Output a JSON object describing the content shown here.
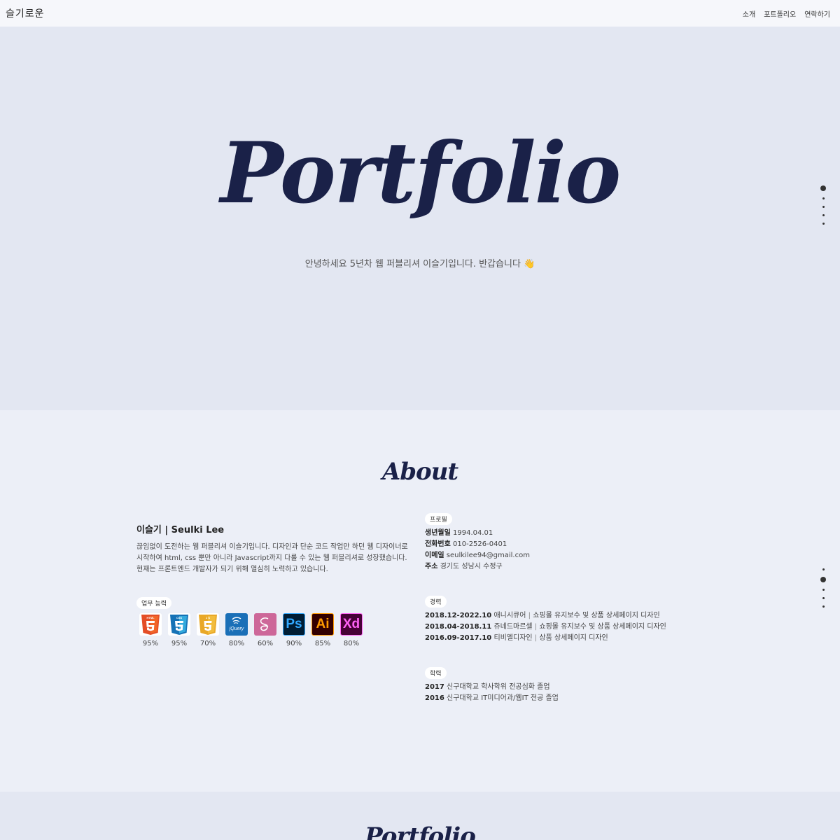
{
  "header": {
    "logo": "슬기로운",
    "nav": [
      {
        "label": "소개"
      },
      {
        "label": "포트폴리오"
      },
      {
        "label": "연락하기"
      }
    ]
  },
  "hero": {
    "title": "Portfolio",
    "subtitle": "안녕하세요 5년차 웹 퍼블리셔 이슬기입니다. 반갑습니다 👋"
  },
  "about": {
    "title": "About",
    "name": "이슬기 | Seulki Lee",
    "bio": [
      "끊임없이 도전하는 웹 퍼블리셔 이슬기입니다. 디자인과 단순 코드 작업만 하던 웹 디자이너로",
      "시작하여 html, css 뿐만 아니라 Javascript까지 다룰 수 있는 웹 퍼블리셔로 성장했습니다.",
      "현재는 프론트엔드 개발자가 되기 위해 열심히 노력하고 있습니다."
    ],
    "skills_label": "업무 능력",
    "skills": [
      {
        "name": "HTML5",
        "icon": "html5-icon",
        "percent": "95%",
        "color": "#e44d26"
      },
      {
        "name": "CSS3",
        "icon": "css3-icon",
        "percent": "95%",
        "color": "#1b73ba"
      },
      {
        "name": "JS",
        "icon": "js-icon",
        "percent": "70%",
        "color": "#e9a827"
      },
      {
        "name": "jQuery",
        "icon": "jquery-icon",
        "percent": "80%",
        "color": "#1a6fb7"
      },
      {
        "name": "Sass",
        "icon": "sass-icon",
        "percent": "60%",
        "color": "#cd6799"
      },
      {
        "name": "Ps",
        "icon": "photoshop-icon",
        "percent": "90%",
        "color": "#001d34"
      },
      {
        "name": "Ai",
        "icon": "illustrator-icon",
        "percent": "85%",
        "color": "#330000"
      },
      {
        "name": "Xd",
        "icon": "xd-icon",
        "percent": "80%",
        "color": "#470137"
      }
    ],
    "profile": {
      "label": "프로필",
      "rows": [
        {
          "key": "생년월일",
          "value": "1994.04.01"
        },
        {
          "key": "전화번호",
          "value": "010-2526-0401"
        },
        {
          "key": "이메일",
          "value": "seulkilee94@gmail.com"
        },
        {
          "key": "주소",
          "value": "경기도 성남시 수정구"
        }
      ]
    },
    "career": {
      "label": "경력",
      "rows": [
        {
          "period": "2018.12-2022.10",
          "company": "애니시큐어",
          "desc": "쇼핑몰 유지보수 및 상품 상세페이지 디자인"
        },
        {
          "period": "2018.04-2018.11",
          "company": "쥬네드마르셀",
          "desc": "쇼핑몰 유지보수 및 상품 상세페이지 디자인"
        },
        {
          "period": "2016.09-2017.10",
          "company": "티비엘디자인",
          "desc": "상품 상세페이지 디자인"
        }
      ]
    },
    "education": {
      "label": "학력",
      "rows": [
        {
          "year": "2017",
          "desc": "신구대학교 학사학위 전공심화 졸업"
        },
        {
          "year": "2016",
          "desc": "신구대학교 IT미디어과/웹IT 전공 졸업"
        }
      ]
    }
  },
  "portfolio": {
    "title": "Portfolio"
  },
  "colors": {
    "navy": "#1a2148",
    "hero_bg": "#e3e7f2",
    "about_bg": "#eceff7"
  }
}
